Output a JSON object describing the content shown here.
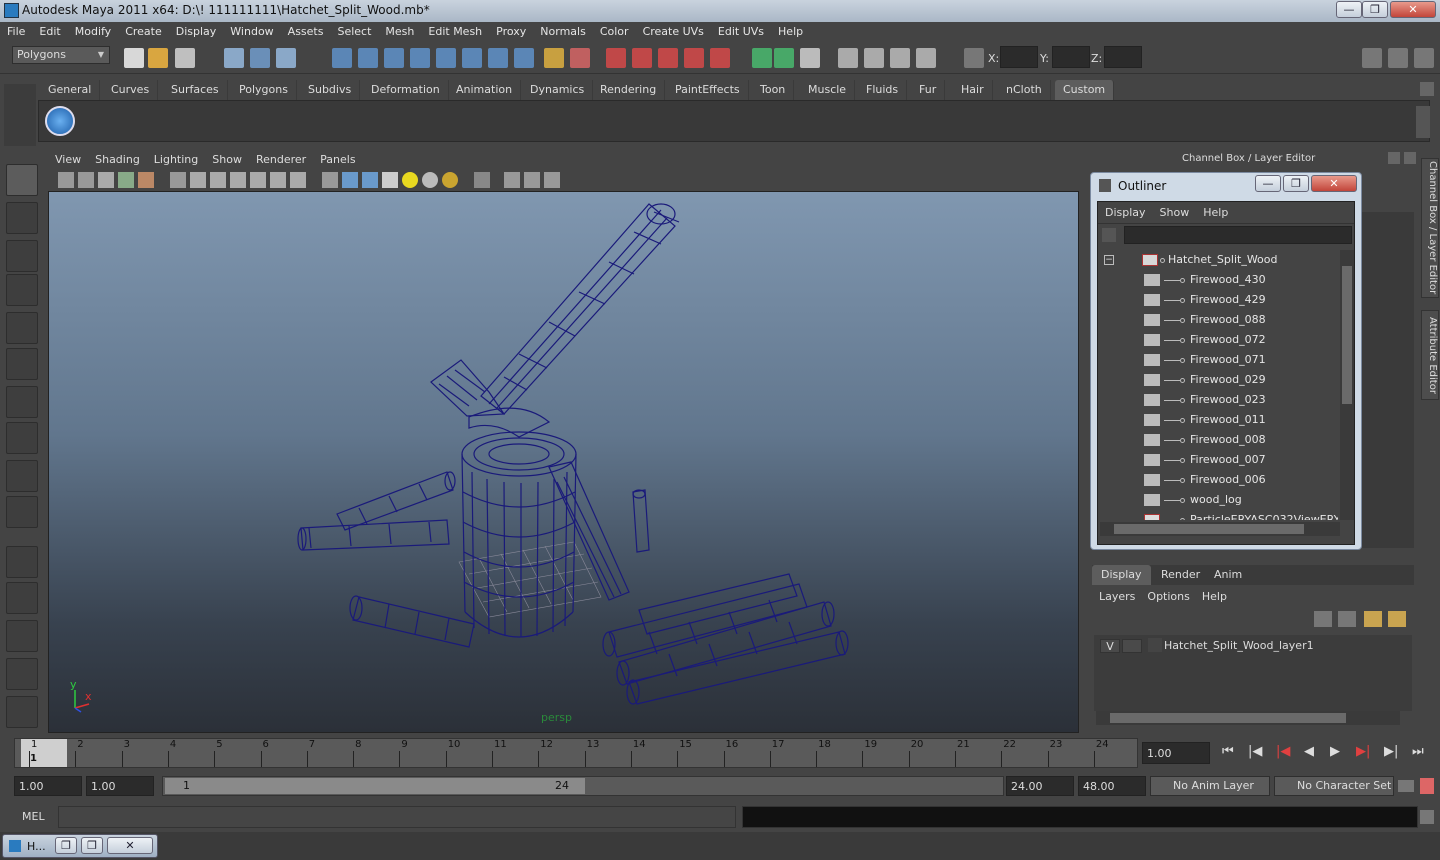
{
  "window": {
    "title": "Autodesk Maya 2011 x64: D:\\! 111111111\\Hatchet_Split_Wood.mb*",
    "minimize": "—",
    "maximize": "❐",
    "close": "✕"
  },
  "menubar": [
    "File",
    "Edit",
    "Modify",
    "Create",
    "Display",
    "Window",
    "Assets",
    "Select",
    "Mesh",
    "Edit Mesh",
    "Proxy",
    "Normals",
    "Color",
    "Create UVs",
    "Edit UVs",
    "Help"
  ],
  "statusline": {
    "mode": "Polygons",
    "x_label": "X:",
    "y_label": "Y:",
    "z_label": "Z:"
  },
  "shelf_tabs": [
    "General",
    "Curves",
    "Surfaces",
    "Polygons",
    "Subdivs",
    "Deformation",
    "Animation",
    "Dynamics",
    "Rendering",
    "PaintEffects",
    "Toon",
    "Muscle",
    "Fluids",
    "Fur",
    "Hair",
    "nCloth",
    "Custom"
  ],
  "shelf_active": "Custom",
  "viewport": {
    "menu": [
      "View",
      "Shading",
      "Lighting",
      "Show",
      "Renderer",
      "Panels"
    ],
    "camera_label": "persp",
    "axis_x": "x",
    "axis_y": "y"
  },
  "rightpanel": {
    "header": "Channel Box / Layer Editor",
    "side_tab_1": "Channel Box / Layer Editor",
    "side_tab_2": "Attribute Editor"
  },
  "outliner": {
    "title": "Outliner",
    "menu": [
      "Display",
      "Show",
      "Help"
    ],
    "root": "Hatchet_Split_Wood",
    "children": [
      "Firewood_430",
      "Firewood_429",
      "Firewood_088",
      "Firewood_072",
      "Firewood_071",
      "Firewood_029",
      "Firewood_023",
      "Firewood_011",
      "Firewood_008",
      "Firewood_007",
      "Firewood_006",
      "wood_log"
    ],
    "partial_item": "ParticleERYASC032ViewERYAS",
    "collapse": "−"
  },
  "layer_editor": {
    "tabs": [
      "Display",
      "Render",
      "Anim"
    ],
    "active_tab": "Display",
    "menu": [
      "Layers",
      "Options",
      "Help"
    ],
    "layer_visible": "V",
    "layer_name": "Hatchet_Split_Wood_layer1"
  },
  "timeline": {
    "ticks": [
      "1",
      "2",
      "3",
      "4",
      "5",
      "6",
      "7",
      "8",
      "9",
      "10",
      "11",
      "12",
      "13",
      "14",
      "15",
      "16",
      "17",
      "18",
      "19",
      "20",
      "21",
      "22",
      "23",
      "24"
    ],
    "current_frame": "1",
    "current_time": "1.00"
  },
  "range": {
    "start": "1.00",
    "playback_start": "1.00",
    "slider_start": "1",
    "slider_end": "24",
    "playback_end": "24.00",
    "end": "48.00",
    "anim_layer": "No Anim Layer",
    "character_set": "No Character Set"
  },
  "command": {
    "label": "MEL"
  },
  "taskbar": {
    "item": "H..."
  },
  "colors": {
    "bg": "#444444",
    "wire": "#1a1a7a",
    "accent": "#5d5d5d"
  }
}
